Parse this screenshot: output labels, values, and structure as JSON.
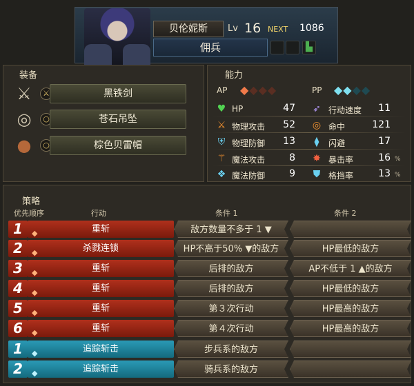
{
  "unit": {
    "name": "贝伦妮斯",
    "lv_label": "Lv",
    "level": "16",
    "next_label": "NEXT",
    "next_exp": "1086",
    "class": "佣兵"
  },
  "equipment": {
    "title": "装备",
    "items": [
      {
        "name": "黑铁剑",
        "icon": "sword-icon"
      },
      {
        "name": "苍石吊坠",
        "icon": "pendant-icon"
      },
      {
        "name": "棕色贝雷帽",
        "icon": "hat-icon"
      }
    ]
  },
  "abilities": {
    "title": "能力",
    "ap_label": "AP",
    "pp_label": "PP",
    "ap_filled": 1,
    "ap_total": 4,
    "pp_filled": 2,
    "pp_total": 4,
    "left": [
      {
        "label": "HP",
        "value": "47"
      },
      {
        "label": "物理攻击",
        "value": "52"
      },
      {
        "label": "物理防御",
        "value": "13"
      },
      {
        "label": "魔法攻击",
        "value": "8"
      },
      {
        "label": "魔法防御",
        "value": "9"
      }
    ],
    "right": [
      {
        "label": "行动速度",
        "value": "11",
        "unit": ""
      },
      {
        "label": "命中",
        "value": "121",
        "unit": ""
      },
      {
        "label": "闪避",
        "value": "17",
        "unit": ""
      },
      {
        "label": "暴击率",
        "value": "16",
        "unit": "%"
      },
      {
        "label": "格挡率",
        "value": "13",
        "unit": "%"
      }
    ]
  },
  "strategy": {
    "title": "策略",
    "headers": {
      "priority": "优先顺序",
      "action": "行动",
      "cond1": "条件 1",
      "cond2": "条件 2"
    },
    "rows": [
      {
        "num": "1",
        "action": "重斩",
        "c1": "敌方数量不多于 1 ▼",
        "c2": ""
      },
      {
        "num": "2",
        "action": "杀戮连锁",
        "c1": "HP不高于50% ▼的敌方",
        "c2": "HP最低的敌方"
      },
      {
        "num": "3",
        "action": "重斩",
        "c1": "后排的敌方",
        "c2": "AP不低于 1 ▲的敌方"
      },
      {
        "num": "4",
        "action": "重斩",
        "c1": "后排的敌方",
        "c2": "HP最低的敌方"
      },
      {
        "num": "5",
        "action": "重斩",
        "c1": "第３次行动",
        "c2": "HP最高的敌方"
      },
      {
        "num": "6",
        "action": "重斩",
        "c1": "第４次行动",
        "c2": "HP最高的敌方"
      },
      {
        "num": "1",
        "action": "追踪斩击",
        "c1": "步兵系的敌方",
        "c2": ""
      },
      {
        "num": "2",
        "action": "追踪斩击",
        "c1": "骑兵系的敌方",
        "c2": ""
      }
    ]
  }
}
